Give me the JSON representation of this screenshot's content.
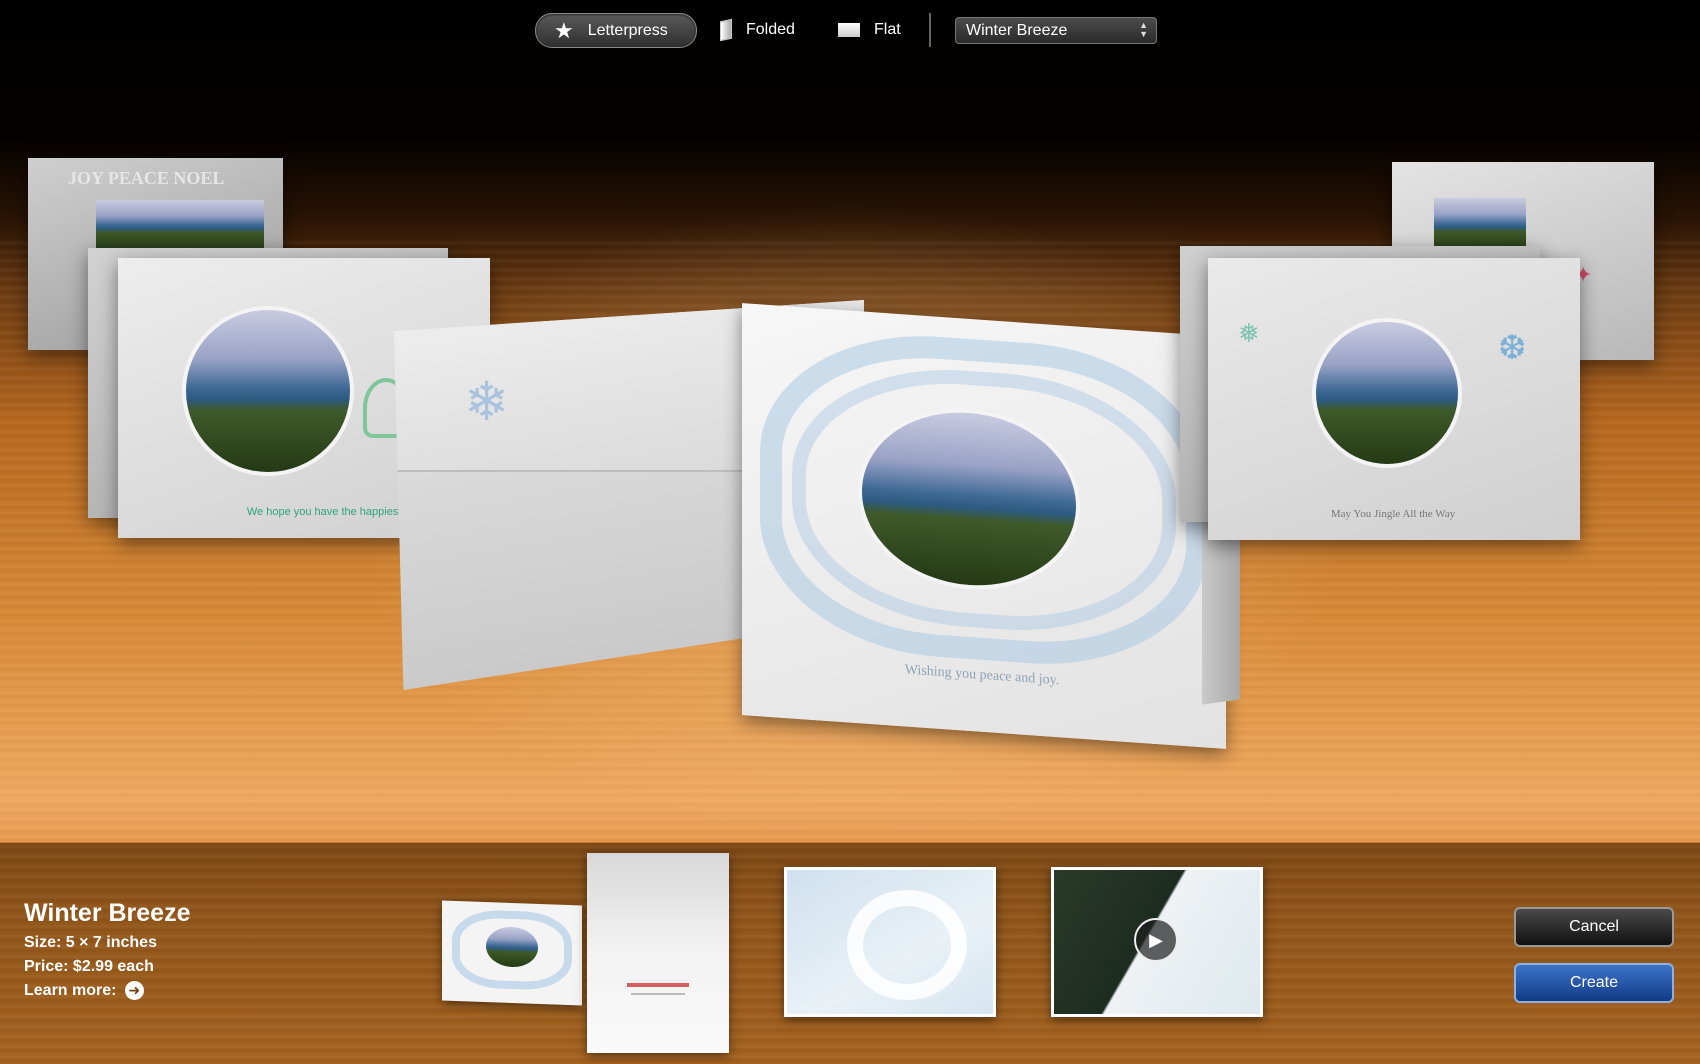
{
  "toolbar": {
    "styles": [
      {
        "label": "Letterpress",
        "icon": "star-icon",
        "selected": true
      },
      {
        "label": "Folded",
        "icon": "folded-card-icon",
        "selected": false
      },
      {
        "label": "Flat",
        "icon": "flat-card-icon",
        "selected": false
      }
    ],
    "theme_popup": {
      "value": "Winter Breeze"
    }
  },
  "cards": {
    "left_front_caption": "We hope you have the happiest season o",
    "center_caption": "Wishing you peace and joy.",
    "right_front_caption": "May You Jingle All the Way",
    "left_back_words": "JOY  PEACE  NOEL"
  },
  "details": {
    "name": "Winter Breeze",
    "size_label": "Size:",
    "size_value": "5 × 7 inches",
    "price_label": "Price:",
    "price_value": "$2.99 each",
    "learn_more": "Learn more:",
    "learn_icon": "arrow-right-icon"
  },
  "buttons": {
    "cancel": "Cancel",
    "create": "Create"
  },
  "colors": {
    "create_blue": "#1e4fa6",
    "wood": "#d98a36",
    "snow_blue": "#a9c8e4"
  }
}
